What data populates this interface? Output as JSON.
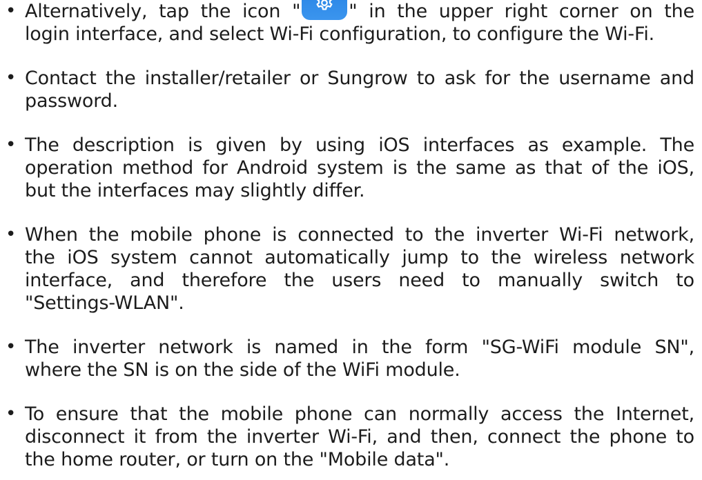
{
  "notes": [
    {
      "lines": [
        {
          "before": "Alternatively, tap the icon \"",
          "icon": "settings-gear-icon",
          "after": "\" in the upper right corner on the"
        },
        {
          "text": "login interface, and select Wi-Fi configuration, to configure the Wi-Fi."
        }
      ]
    },
    {
      "lines": [
        {
          "text": "Contact the installer/retailer or Sungrow to ask for the username and"
        },
        {
          "text": "password."
        }
      ]
    },
    {
      "lines": [
        {
          "text": "The description is given by using iOS interfaces as example. The"
        },
        {
          "text": "operation method for Android system is the same as that of the iOS,"
        },
        {
          "text": "but the interfaces may slightly differ."
        }
      ]
    },
    {
      "lines": [
        {
          "text": "When the mobile phone is connected to the inverter Wi-Fi network,"
        },
        {
          "text": "the iOS system cannot automatically jump to the wireless network"
        },
        {
          "text": "interface, and therefore the users need to manually switch to"
        },
        {
          "text": "\"Settings-WLAN\"."
        }
      ]
    },
    {
      "lines": [
        {
          "text": "The inverter network is named in the form \"SG-WiFi module SN\","
        },
        {
          "text": "where the SN is on the side of the WiFi module."
        }
      ]
    },
    {
      "lines": [
        {
          "text": "To ensure that the mobile phone can normally access the Internet,"
        },
        {
          "text": "disconnect it from the inverter Wi-Fi, and then, connect the phone to"
        },
        {
          "text": "the home router, or turn on the \"Mobile data\"."
        }
      ]
    }
  ],
  "bullet_glyph": "•",
  "colors": {
    "text": "#1c1c1c",
    "icon_background": "#2a86e6",
    "icon_glyph": "#ffffff"
  }
}
